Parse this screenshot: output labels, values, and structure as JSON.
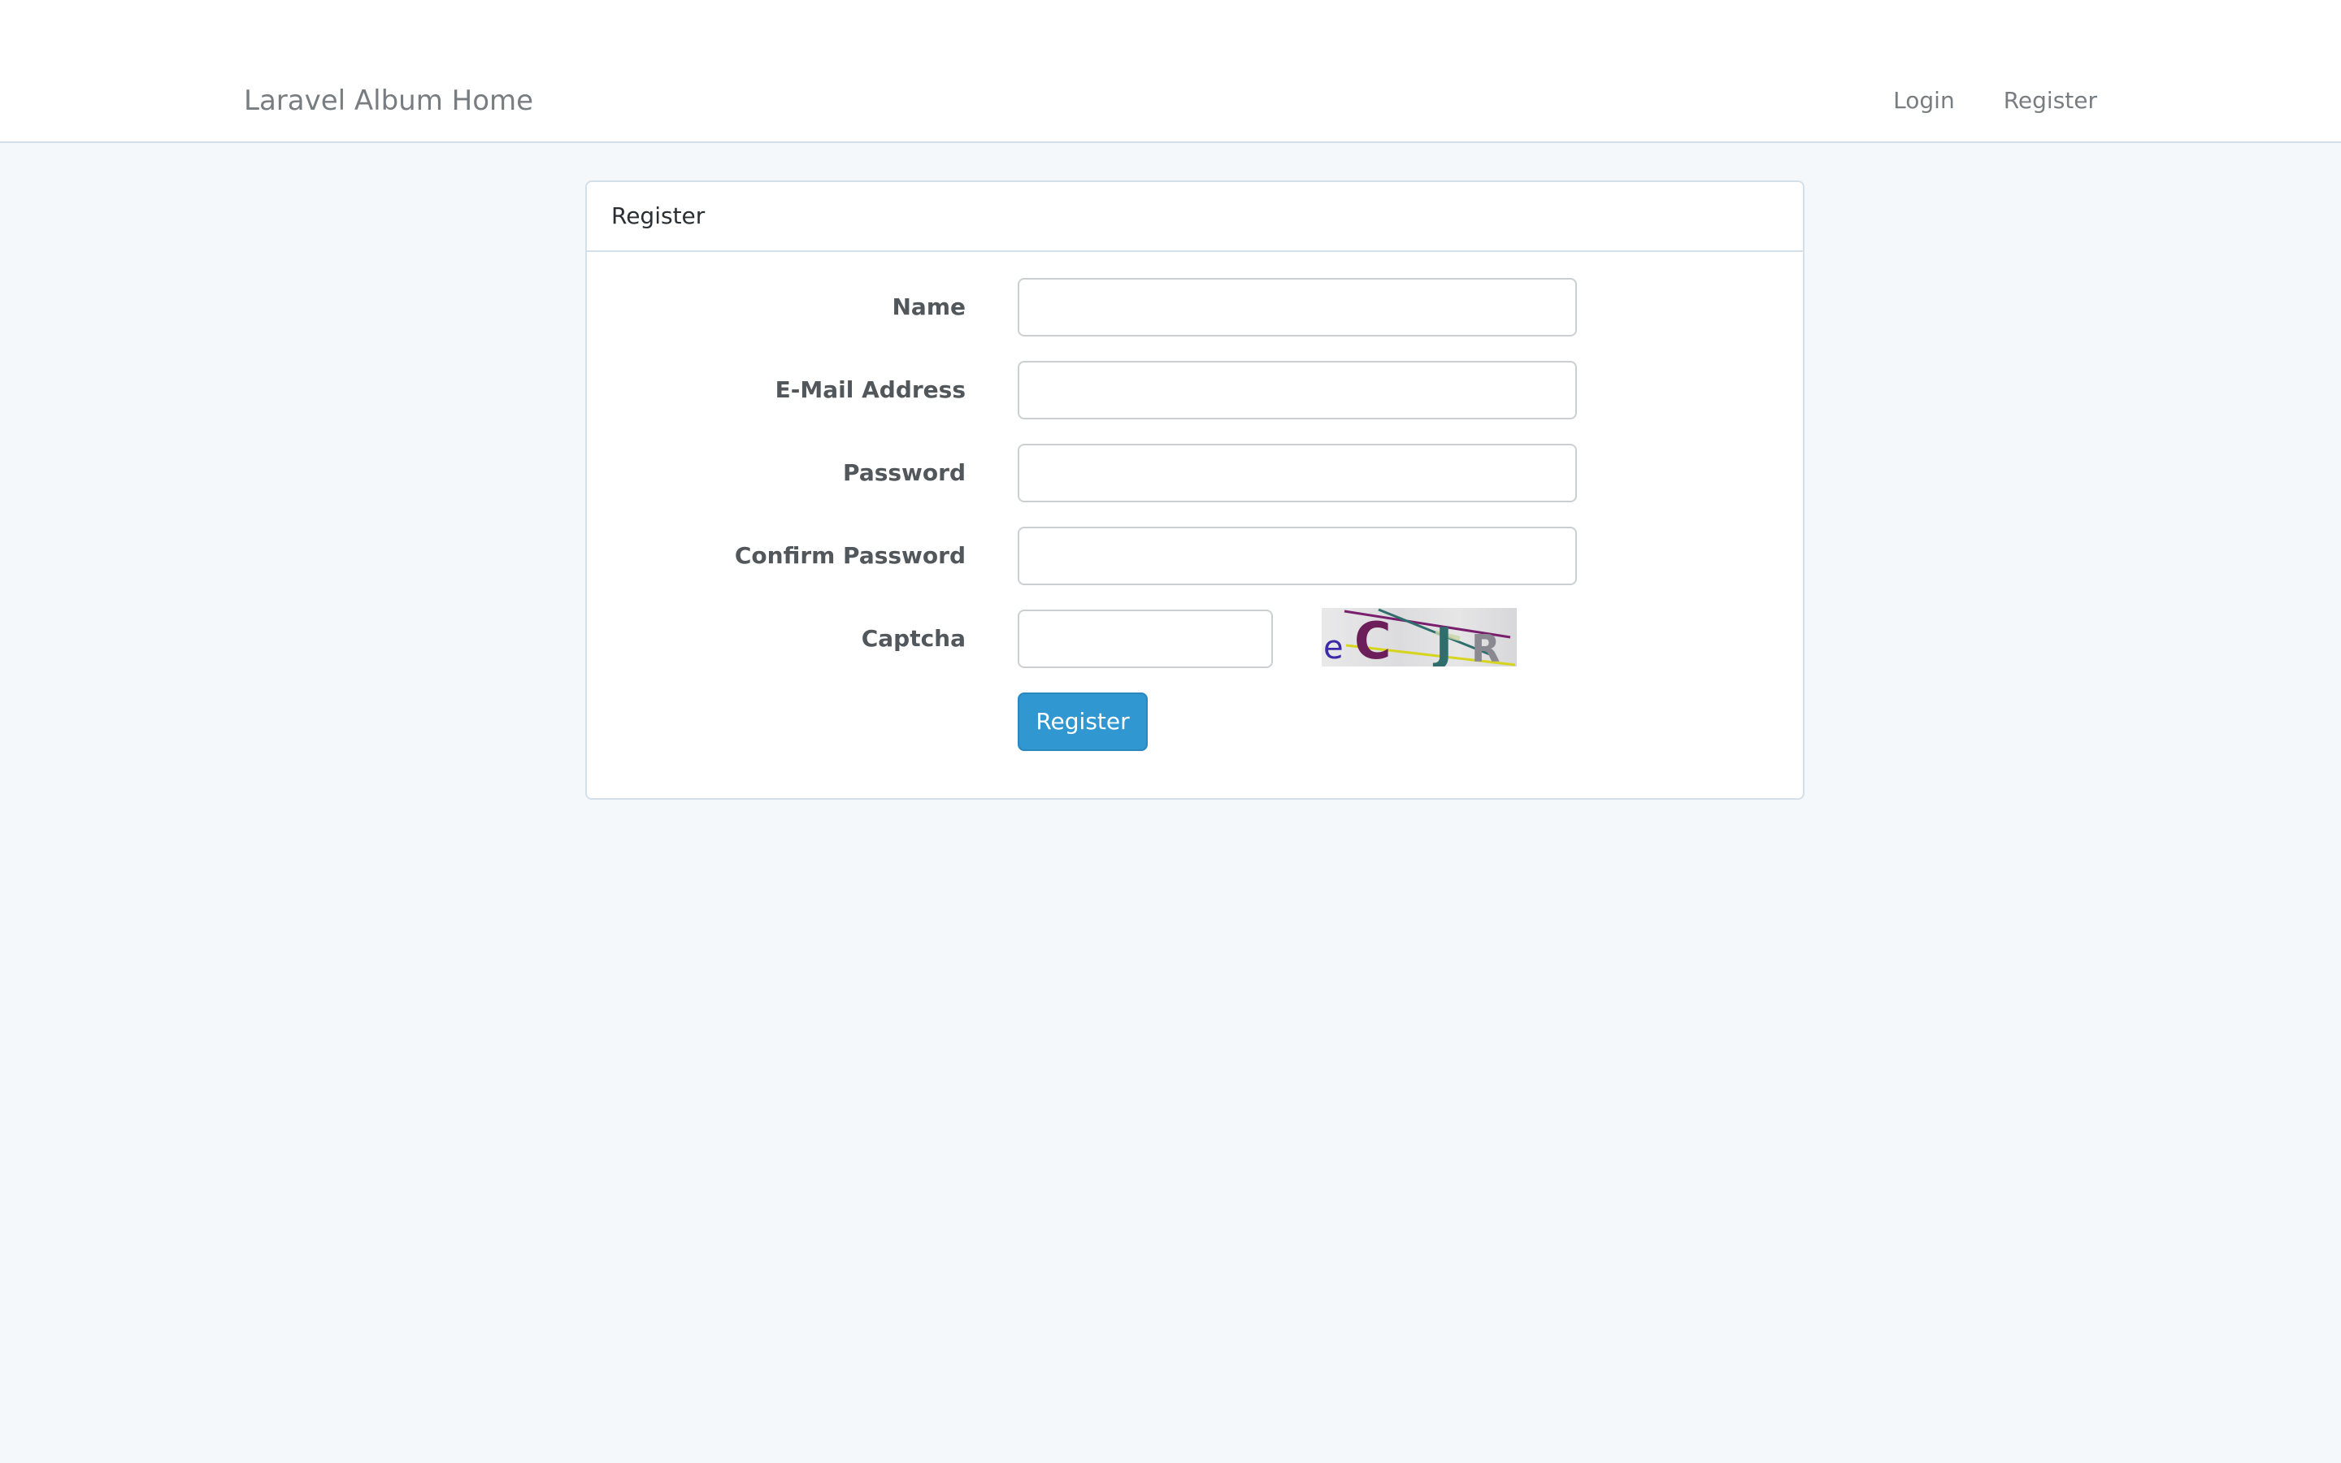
{
  "navbar": {
    "brand": "Laravel Album Home",
    "links": [
      {
        "label": "Login"
      },
      {
        "label": "Register"
      }
    ]
  },
  "panel": {
    "title": "Register",
    "fields": {
      "name": {
        "label": "Name",
        "value": ""
      },
      "email": {
        "label": "E-Mail Address",
        "value": ""
      },
      "password": {
        "label": "Password",
        "value": ""
      },
      "password_confirm": {
        "label": "Confirm Password",
        "value": ""
      },
      "captcha": {
        "label": "Captcha",
        "value": ""
      }
    },
    "captcha_image": {
      "text": "eCJR"
    },
    "submit_label": "Register"
  },
  "colors": {
    "background": "#f5f8fa",
    "navbar_bg": "#ffffff",
    "border": "#d3e0e9",
    "primary_button": "#3097d1",
    "label_text": "#52575b"
  }
}
